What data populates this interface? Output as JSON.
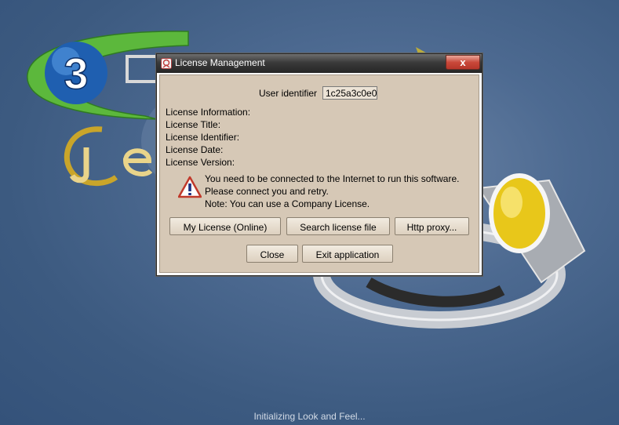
{
  "splash": {
    "logo_numeral": "3",
    "status_text": "Initializing Look and Feel..."
  },
  "dialog": {
    "title": "License Management",
    "title_icon": "license-app-icon",
    "close_glyph": "x",
    "user_identifier_label": "User identifier",
    "user_identifier_value": "1c25a3c0e0",
    "info": {
      "information_label": "License Information:",
      "title_label": "License Title:",
      "identifier_label": "License Identifier:",
      "date_label": "License Date:",
      "version_label": "License Version:"
    },
    "warning": {
      "icon": "warning-icon",
      "line1": "You need to be connected to the Internet to run this software.",
      "line2": "Please connect you and retry.",
      "line3": "Note: You can use a Company License."
    },
    "buttons": {
      "my_license": "My License (Online)",
      "search_license": "Search license file",
      "http_proxy": "Http proxy...",
      "close": "Close",
      "exit": "Exit application"
    }
  },
  "colors": {
    "background": "#3c5a80",
    "dialog_body": "#d6c8b6",
    "close_button": "#c9483a",
    "logo_green": "#5cb83c",
    "logo_blue": "#1f5fb0",
    "gem_yellow": "#e8c71a"
  }
}
